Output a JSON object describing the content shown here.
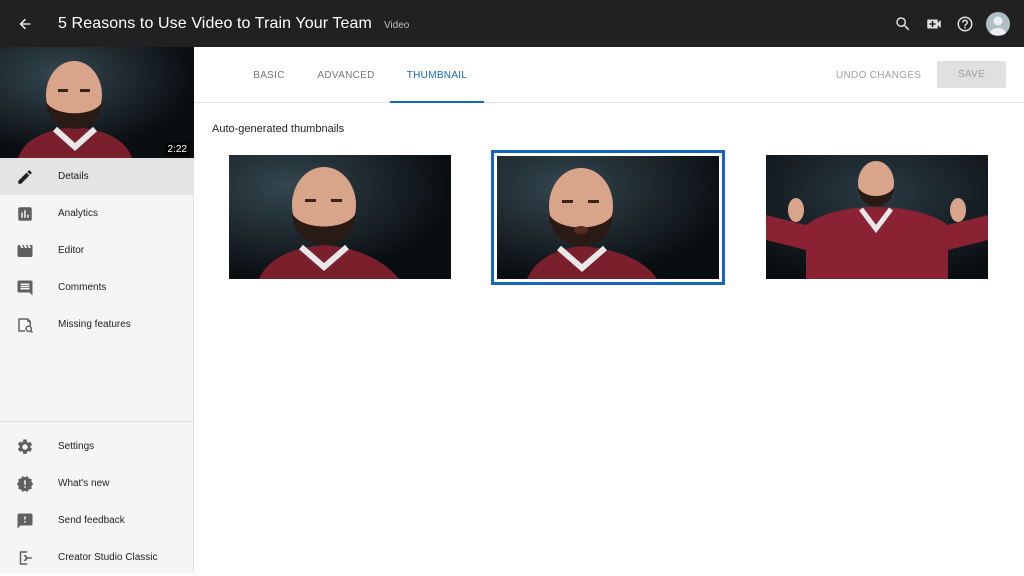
{
  "header": {
    "title": "5 Reasons to Use Video to Train Your Team",
    "badge": "Video"
  },
  "sidebar": {
    "video_duration": "2:22",
    "items": [
      {
        "label": "Details",
        "icon": "pencil-icon",
        "active": true
      },
      {
        "label": "Analytics",
        "icon": "bar-chart-icon"
      },
      {
        "label": "Editor",
        "icon": "clapperboard-icon"
      },
      {
        "label": "Comments",
        "icon": "comment-icon"
      },
      {
        "label": "Missing features",
        "icon": "missing-features-icon"
      }
    ],
    "bottom_items": [
      {
        "label": "Settings",
        "icon": "gear-icon"
      },
      {
        "label": "What's new",
        "icon": "alert-badge-icon"
      },
      {
        "label": "Send feedback",
        "icon": "feedback-icon"
      },
      {
        "label": "Creator Studio Classic",
        "icon": "exit-icon"
      }
    ]
  },
  "tabs": [
    {
      "label": "BASIC"
    },
    {
      "label": "ADVANCED"
    },
    {
      "label": "THUMBNAIL",
      "active": true
    }
  ],
  "actions": {
    "undo_label": "UNDO CHANGES",
    "save_label": "SAVE"
  },
  "thumbnails": {
    "section_label": "Auto-generated thumbnails",
    "selected_index": 1,
    "count": 3
  },
  "colors": {
    "accent": "#1565c0",
    "topbar": "#212121",
    "sidebar_bg": "#f5f5f5"
  }
}
